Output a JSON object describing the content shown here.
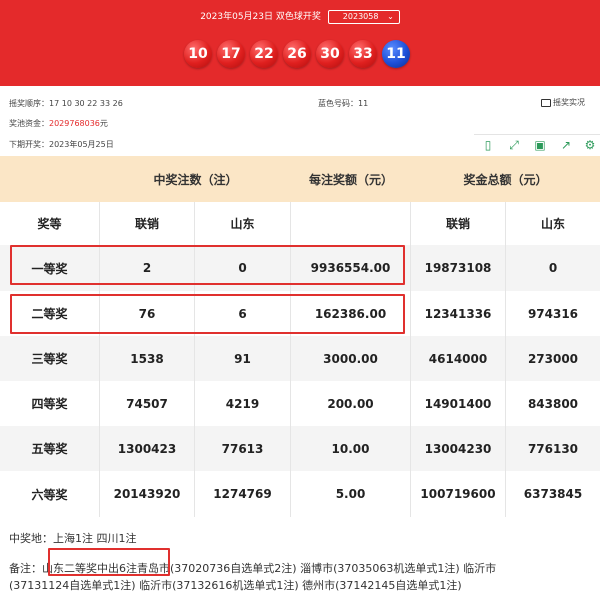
{
  "header": {
    "date_text": "2023年05月23日",
    "game_name": "双色球",
    "draw_suffix": "开奖",
    "issue_value": "2023058",
    "red_balls": [
      "10",
      "17",
      "22",
      "26",
      "30",
      "33"
    ],
    "blue_ball": "11"
  },
  "info": {
    "draw_order_label": "摇奖顺序：",
    "draw_order": "17 10 30 22 33 26",
    "blue_label": "蓝色号码：",
    "blue_value": "11",
    "video_label": "摇奖实况",
    "pool_label": "奖池资金：",
    "pool_value": "2029768036",
    "pool_unit": "元",
    "next_label": "下期开奖：",
    "next_value": "2023年05月25日"
  },
  "table": {
    "group_headers": [
      "中奖注数（注）",
      "每注奖额（元）",
      "奖金总额（元）"
    ],
    "sub_headers": [
      "奖等",
      "联销",
      "山东",
      "",
      "联销",
      "山东"
    ],
    "rows": [
      [
        "一等奖",
        "2",
        "0",
        "9936554.00",
        "19873108",
        "0"
      ],
      [
        "二等奖",
        "76",
        "6",
        "162386.00",
        "12341336",
        "974316"
      ],
      [
        "三等奖",
        "1538",
        "91",
        "3000.00",
        "4614000",
        "273000"
      ],
      [
        "四等奖",
        "74507",
        "4219",
        "200.00",
        "14901400",
        "843800"
      ],
      [
        "五等奖",
        "1300423",
        "77613",
        "10.00",
        "13004230",
        "776130"
      ],
      [
        "六等奖",
        "20143920",
        "1274769",
        "5.00",
        "100719600",
        "6373845"
      ]
    ]
  },
  "notes": {
    "winners_location": "中奖地：上海1注 四川1注",
    "remark_label": "备注：",
    "remark_highlight": "山东二等奖中出6注",
    "remark_line1_rest": "青岛市(37020736自选单式2注) 淄博市(37035063机选单式1注) 临沂市",
    "remark_line2": "(37131124自选单式1注) 临沂市(37132616机选单式1注) 德州市(37142145自选单式1注)"
  },
  "colors": {
    "header_red": "#e42a2b",
    "red_ball": "#e0201f",
    "blue_ball": "#1d4fd8",
    "table_head": "#fbe6c6",
    "highlight_box": "#e0302e",
    "tool_green": "#2c9a5a"
  }
}
